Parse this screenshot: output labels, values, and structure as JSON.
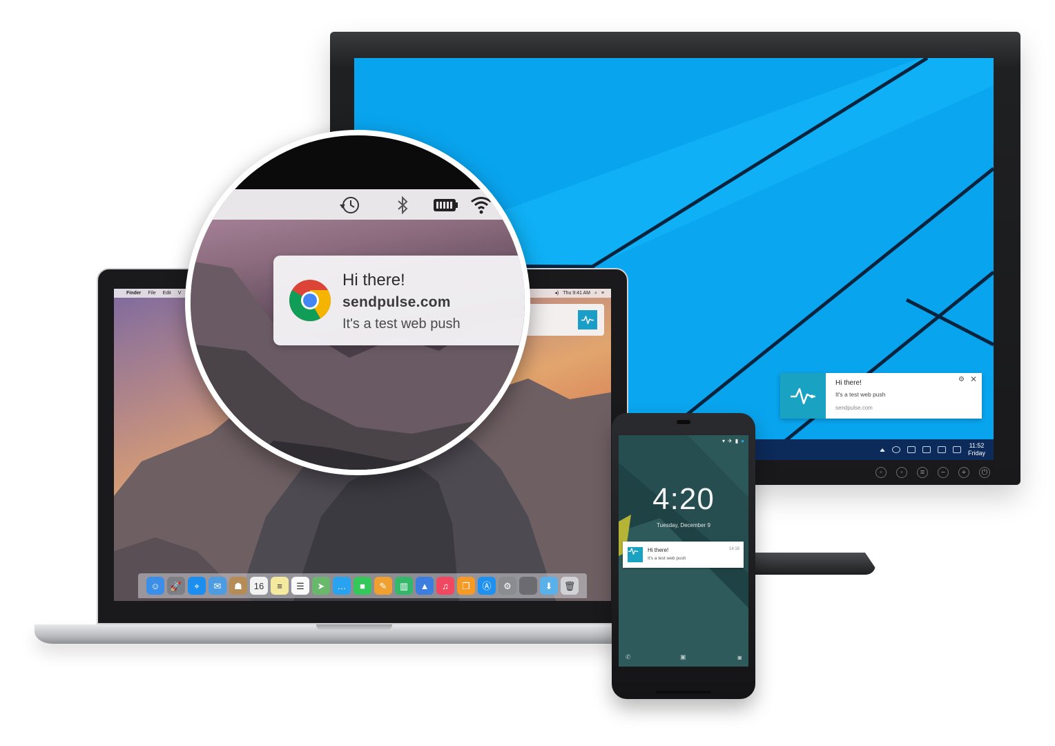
{
  "colors": {
    "windows_blue": "#09a4ee",
    "sendpulse_teal": "#1aa2c2",
    "android_bg": "#264d4f"
  },
  "icons": {
    "sendpulse": "pulse-line-icon",
    "chrome": "chrome-logo-icon",
    "time_machine": "clock-history-icon",
    "bluetooth": "bluetooth-icon",
    "battery": "battery-icon",
    "wifi": "wifi-icon"
  },
  "mac": {
    "menubar": {
      "app": "Finder",
      "items": [
        "File",
        "Edit",
        "V"
      ],
      "clock": "Thu 9:41 AM"
    },
    "dock_apps": [
      {
        "name": "finder",
        "glyph": "☺",
        "color": "#3b8fe8"
      },
      {
        "name": "launchpad",
        "glyph": "🚀",
        "color": "#7c7f86"
      },
      {
        "name": "safari",
        "glyph": "⌖",
        "color": "#1b8ef0"
      },
      {
        "name": "mail",
        "glyph": "✉",
        "color": "#4d9be0"
      },
      {
        "name": "contacts",
        "glyph": "☗",
        "color": "#b58c55"
      },
      {
        "name": "calendar",
        "glyph": "16",
        "color": "#f2f2f2"
      },
      {
        "name": "notes",
        "glyph": "≡",
        "color": "#f5e9a0"
      },
      {
        "name": "reminders",
        "glyph": "☰",
        "color": "#fafafa"
      },
      {
        "name": "maps",
        "glyph": "➤",
        "color": "#6ab86c"
      },
      {
        "name": "messages",
        "glyph": "…",
        "color": "#29a3f0"
      },
      {
        "name": "facetime",
        "glyph": "■",
        "color": "#34c759"
      },
      {
        "name": "pages",
        "glyph": "✎",
        "color": "#f0a030"
      },
      {
        "name": "numbers",
        "glyph": "▥",
        "color": "#34b86a"
      },
      {
        "name": "keynote",
        "glyph": "▲",
        "color": "#3c7ee0"
      },
      {
        "name": "itunes",
        "glyph": "♫",
        "color": "#f04860"
      },
      {
        "name": "ibooks",
        "glyph": "❐",
        "color": "#f59a24"
      },
      {
        "name": "app-store",
        "glyph": "Ⓐ",
        "color": "#1e90f0"
      },
      {
        "name": "system-preferences",
        "glyph": "⚙",
        "color": "#8a8c90"
      },
      {
        "name": "blank-app",
        "glyph": "",
        "color": "#6c6c70"
      },
      {
        "name": "downloads-folder",
        "glyph": "⬇",
        "color": "#5ab0e8"
      },
      {
        "name": "trash",
        "glyph": "🗑",
        "color": "#d0d2d6"
      }
    ]
  },
  "zoom_notification": {
    "title": "Hi there!",
    "site": "sendpulse.com",
    "message": "It's a test web push"
  },
  "windows": {
    "toast": {
      "title": "Hi there!",
      "message": "It's a test web push",
      "source": "sendpulse.com"
    },
    "clock": {
      "time": "11:52",
      "day": "Friday"
    }
  },
  "android": {
    "time": "4:20",
    "date": "Tuesday, December 9",
    "notification": {
      "title": "Hi there!",
      "message": "It's a test web push",
      "time": "14:16"
    }
  }
}
